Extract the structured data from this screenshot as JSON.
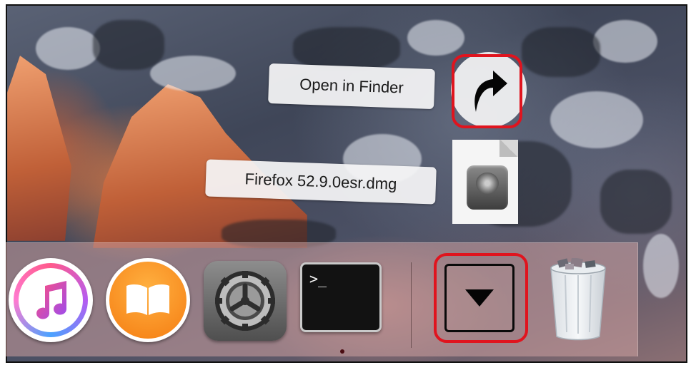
{
  "desktop": {
    "stack_popup": {
      "open_in_finder_label": "Open in Finder",
      "file_name": "Firefox 52.9.0esr.dmg",
      "open_icon": "curved-arrow-icon",
      "file_icon": "dmg-disk-image-icon"
    }
  },
  "dock": {
    "apps": [
      {
        "name": "iTunes",
        "icon": "itunes-icon"
      },
      {
        "name": "iBooks",
        "icon": "ibooks-icon"
      },
      {
        "name": "System Preferences",
        "icon": "gear-icon"
      },
      {
        "name": "Terminal",
        "icon": "terminal-icon",
        "prompt": ">_"
      }
    ],
    "stacks": [
      {
        "name": "Downloads",
        "icon": "triangle-down-icon"
      },
      {
        "name": "Trash",
        "icon": "trash-icon"
      }
    ]
  },
  "colors": {
    "highlight": "#e0141e",
    "dock_indicator": "#4a0d12"
  }
}
